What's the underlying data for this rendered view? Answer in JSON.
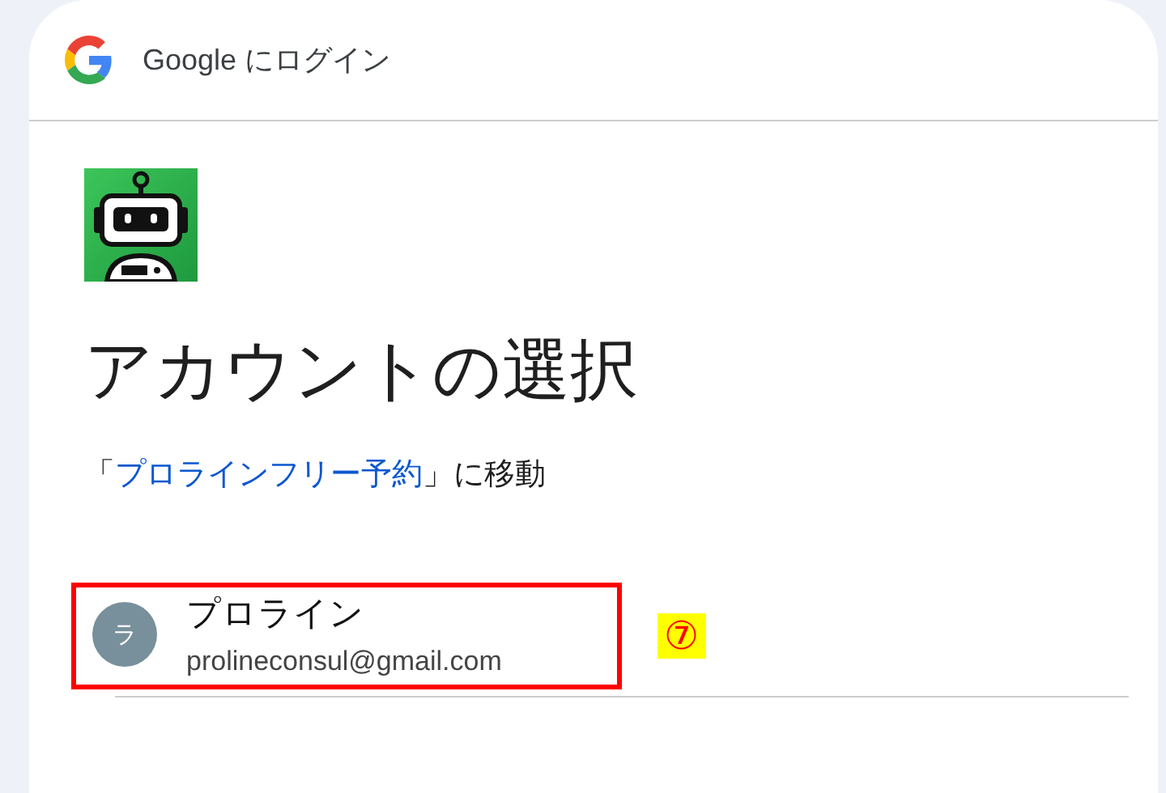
{
  "header": {
    "title": "Google にログイン"
  },
  "heading": "アカウントの選択",
  "subtitle": {
    "before": "「",
    "link": "プロラインフリー予約",
    "after": "」に移動"
  },
  "accounts": [
    {
      "initial": "ラ",
      "name": "プロライン",
      "email": "prolineconsul@gmail.com",
      "highlighted": true
    }
  ],
  "callout": "⑦"
}
